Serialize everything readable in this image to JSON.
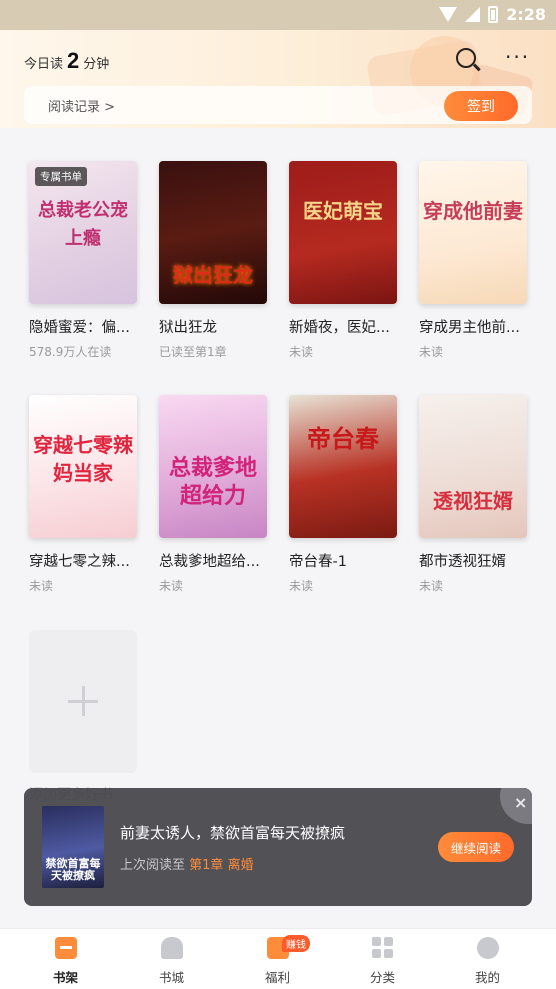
{
  "statusbar": {
    "time": "2:28"
  },
  "header": {
    "read_prefix": "今日读",
    "read_minutes": "2",
    "read_suffix": "分钟",
    "history_label": "阅读记录 >",
    "checkin_label": "签到"
  },
  "books": [
    {
      "title": "隐婚蜜爱：偏...",
      "status": "578.9万人在读",
      "cover_text": "总裁老公宠上瘾",
      "tag": "专属书单"
    },
    {
      "title": "狱出狂龙",
      "status": "已读至第1章",
      "cover_text": "狱出狂龙"
    },
    {
      "title": "新婚夜，医妃...",
      "status": "未读",
      "cover_text": "医妃萌宝"
    },
    {
      "title": "穿成男主他前...",
      "status": "未读",
      "cover_text": "穿成他前妻"
    },
    {
      "title": "穿越七零之辣...",
      "status": "未读",
      "cover_text": "穿越七零辣妈当家"
    },
    {
      "title": "总裁爹地超给...",
      "status": "未读",
      "cover_text": "总裁爹地超给力"
    },
    {
      "title": "帝台春-1",
      "status": "未读",
      "cover_text": "帝台春"
    },
    {
      "title": "都市透视狂婿",
      "status": "未读",
      "cover_text": "透视狂婿"
    }
  ],
  "add_book": {
    "label": "添加更多好书"
  },
  "popup": {
    "title": "前妻太诱人，禁欲首富每天被撩疯",
    "last_read_prefix": "上次阅读至",
    "last_read_chapter": "第1章",
    "last_read_chapter_name": "离婚",
    "cover_text": "禁欲首富每天被撩疯",
    "continue_label": "继续阅读",
    "close_label": "×"
  },
  "tabbar": {
    "items": [
      {
        "label": "书架",
        "icon": "bookshelf-icon",
        "active": true
      },
      {
        "label": "书城",
        "icon": "bookstore-icon",
        "active": false
      },
      {
        "label": "福利",
        "icon": "welfare-icon",
        "badge": "赚钱",
        "active": false
      },
      {
        "label": "分类",
        "icon": "category-icon",
        "active": false
      },
      {
        "label": "我的",
        "icon": "profile-icon",
        "active": false
      }
    ]
  },
  "colors": {
    "accent": "#ff7a30",
    "header_bg": "#fdeed8"
  }
}
